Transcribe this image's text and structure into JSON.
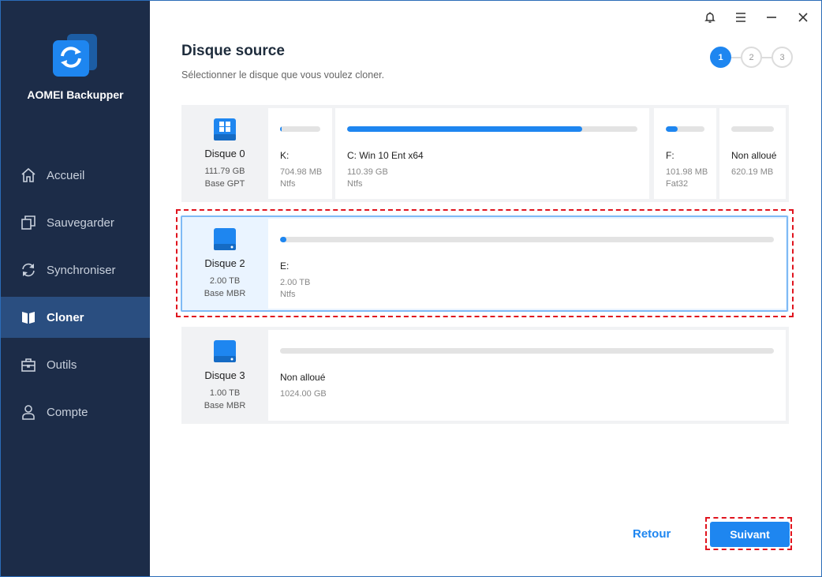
{
  "app": {
    "name": "AOMEI Backupper"
  },
  "nav": {
    "items": [
      {
        "label": "Accueil",
        "icon": "home-icon"
      },
      {
        "label": "Sauvegarder",
        "icon": "backup-icon"
      },
      {
        "label": "Synchroniser",
        "icon": "sync-icon"
      },
      {
        "label": "Cloner",
        "icon": "clone-icon",
        "active": true
      },
      {
        "label": "Outils",
        "icon": "tools-icon"
      },
      {
        "label": "Compte",
        "icon": "account-icon"
      }
    ]
  },
  "header": {
    "title": "Disque source",
    "subtitle": "Sélectionner le disque que vous voulez cloner."
  },
  "steps": [
    "1",
    "2",
    "3"
  ],
  "disks": [
    {
      "name": "Disque 0",
      "size": "111.79 GB",
      "type": "Base GPT",
      "partitions": [
        {
          "name": "K:",
          "size": "704.98 MB",
          "fs": "Ntfs",
          "used": 0.03
        },
        {
          "name": "C: Win 10 Ent x64",
          "size": "110.39 GB",
          "fs": "Ntfs",
          "used": 0.81
        },
        {
          "name": "F:",
          "size": "101.98 MB",
          "fs": "Fat32",
          "used": 0.3
        },
        {
          "name": "Non alloué",
          "size": "620.19 MB",
          "fs": "",
          "used": 0
        }
      ]
    },
    {
      "name": "Disque 2",
      "size": "2.00 TB",
      "type": "Base MBR",
      "partitions": [
        {
          "name": "E:",
          "size": "2.00 TB",
          "fs": "Ntfs",
          "used": 0.005
        }
      ]
    },
    {
      "name": "Disque 3",
      "size": "1.00 TB",
      "type": "Base MBR",
      "partitions": [
        {
          "name": "Non alloué",
          "size": "1024.00 GB",
          "fs": "",
          "used": 0
        }
      ]
    }
  ],
  "buttons": {
    "back": "Retour",
    "next": "Suivant"
  },
  "colors": {
    "accent": "#1e86f0",
    "sidebar": "#1c2c48",
    "highlight": "#e0141e"
  }
}
